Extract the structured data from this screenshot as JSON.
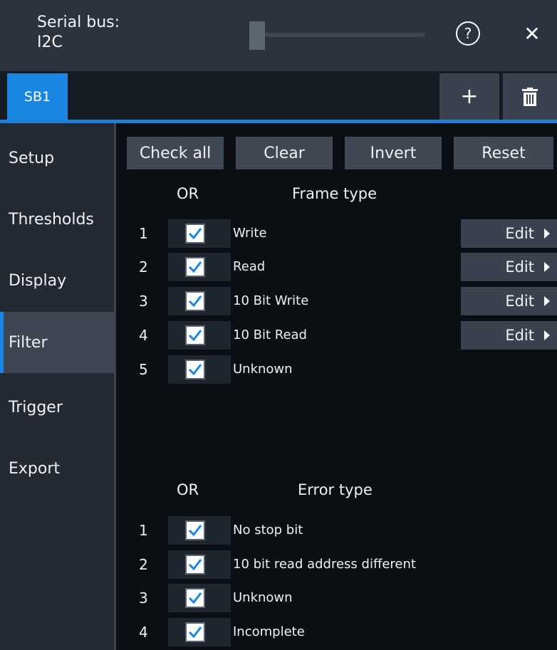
{
  "window": {
    "title_line1": "Serial bus:",
    "title_line2": "I2C",
    "help_icon": "help-icon",
    "close_icon": "close-icon",
    "help_glyph": "?",
    "close_glyph": "✕"
  },
  "tabs": {
    "active": "SB1",
    "add_label": "+",
    "delete_icon": "trash-icon"
  },
  "sidebar": {
    "items": [
      {
        "label": "Setup"
      },
      {
        "label": "Thresholds"
      },
      {
        "label": "Display"
      },
      {
        "label": "Filter"
      },
      {
        "label": "Trigger"
      },
      {
        "label": "Export"
      }
    ],
    "active_index": 3
  },
  "toolbar": {
    "check_all": "Check all",
    "clear": "Clear",
    "invert": "Invert",
    "reset": "Reset"
  },
  "frame_section": {
    "or_header": "OR",
    "type_header": "Frame type",
    "rows": [
      {
        "num": "1",
        "label": "Write",
        "checked": true,
        "edit": "Edit"
      },
      {
        "num": "2",
        "label": "Read",
        "checked": true,
        "edit": "Edit"
      },
      {
        "num": "3",
        "label": "10 Bit Write",
        "checked": true,
        "edit": "Edit"
      },
      {
        "num": "4",
        "label": "10 Bit Read",
        "checked": true,
        "edit": "Edit"
      },
      {
        "num": "5",
        "label": "Unknown",
        "checked": true
      }
    ]
  },
  "error_section": {
    "or_header": "OR",
    "type_header": "Error type",
    "rows": [
      {
        "num": "1",
        "label": "No stop bit",
        "checked": true
      },
      {
        "num": "2",
        "label": "10 bit read address different",
        "checked": true
      },
      {
        "num": "3",
        "label": "Unknown",
        "checked": true
      },
      {
        "num": "4",
        "label": "Incomplete",
        "checked": true
      }
    ]
  },
  "colors": {
    "accent": "#1a86e2",
    "check": "#1a86e2"
  }
}
